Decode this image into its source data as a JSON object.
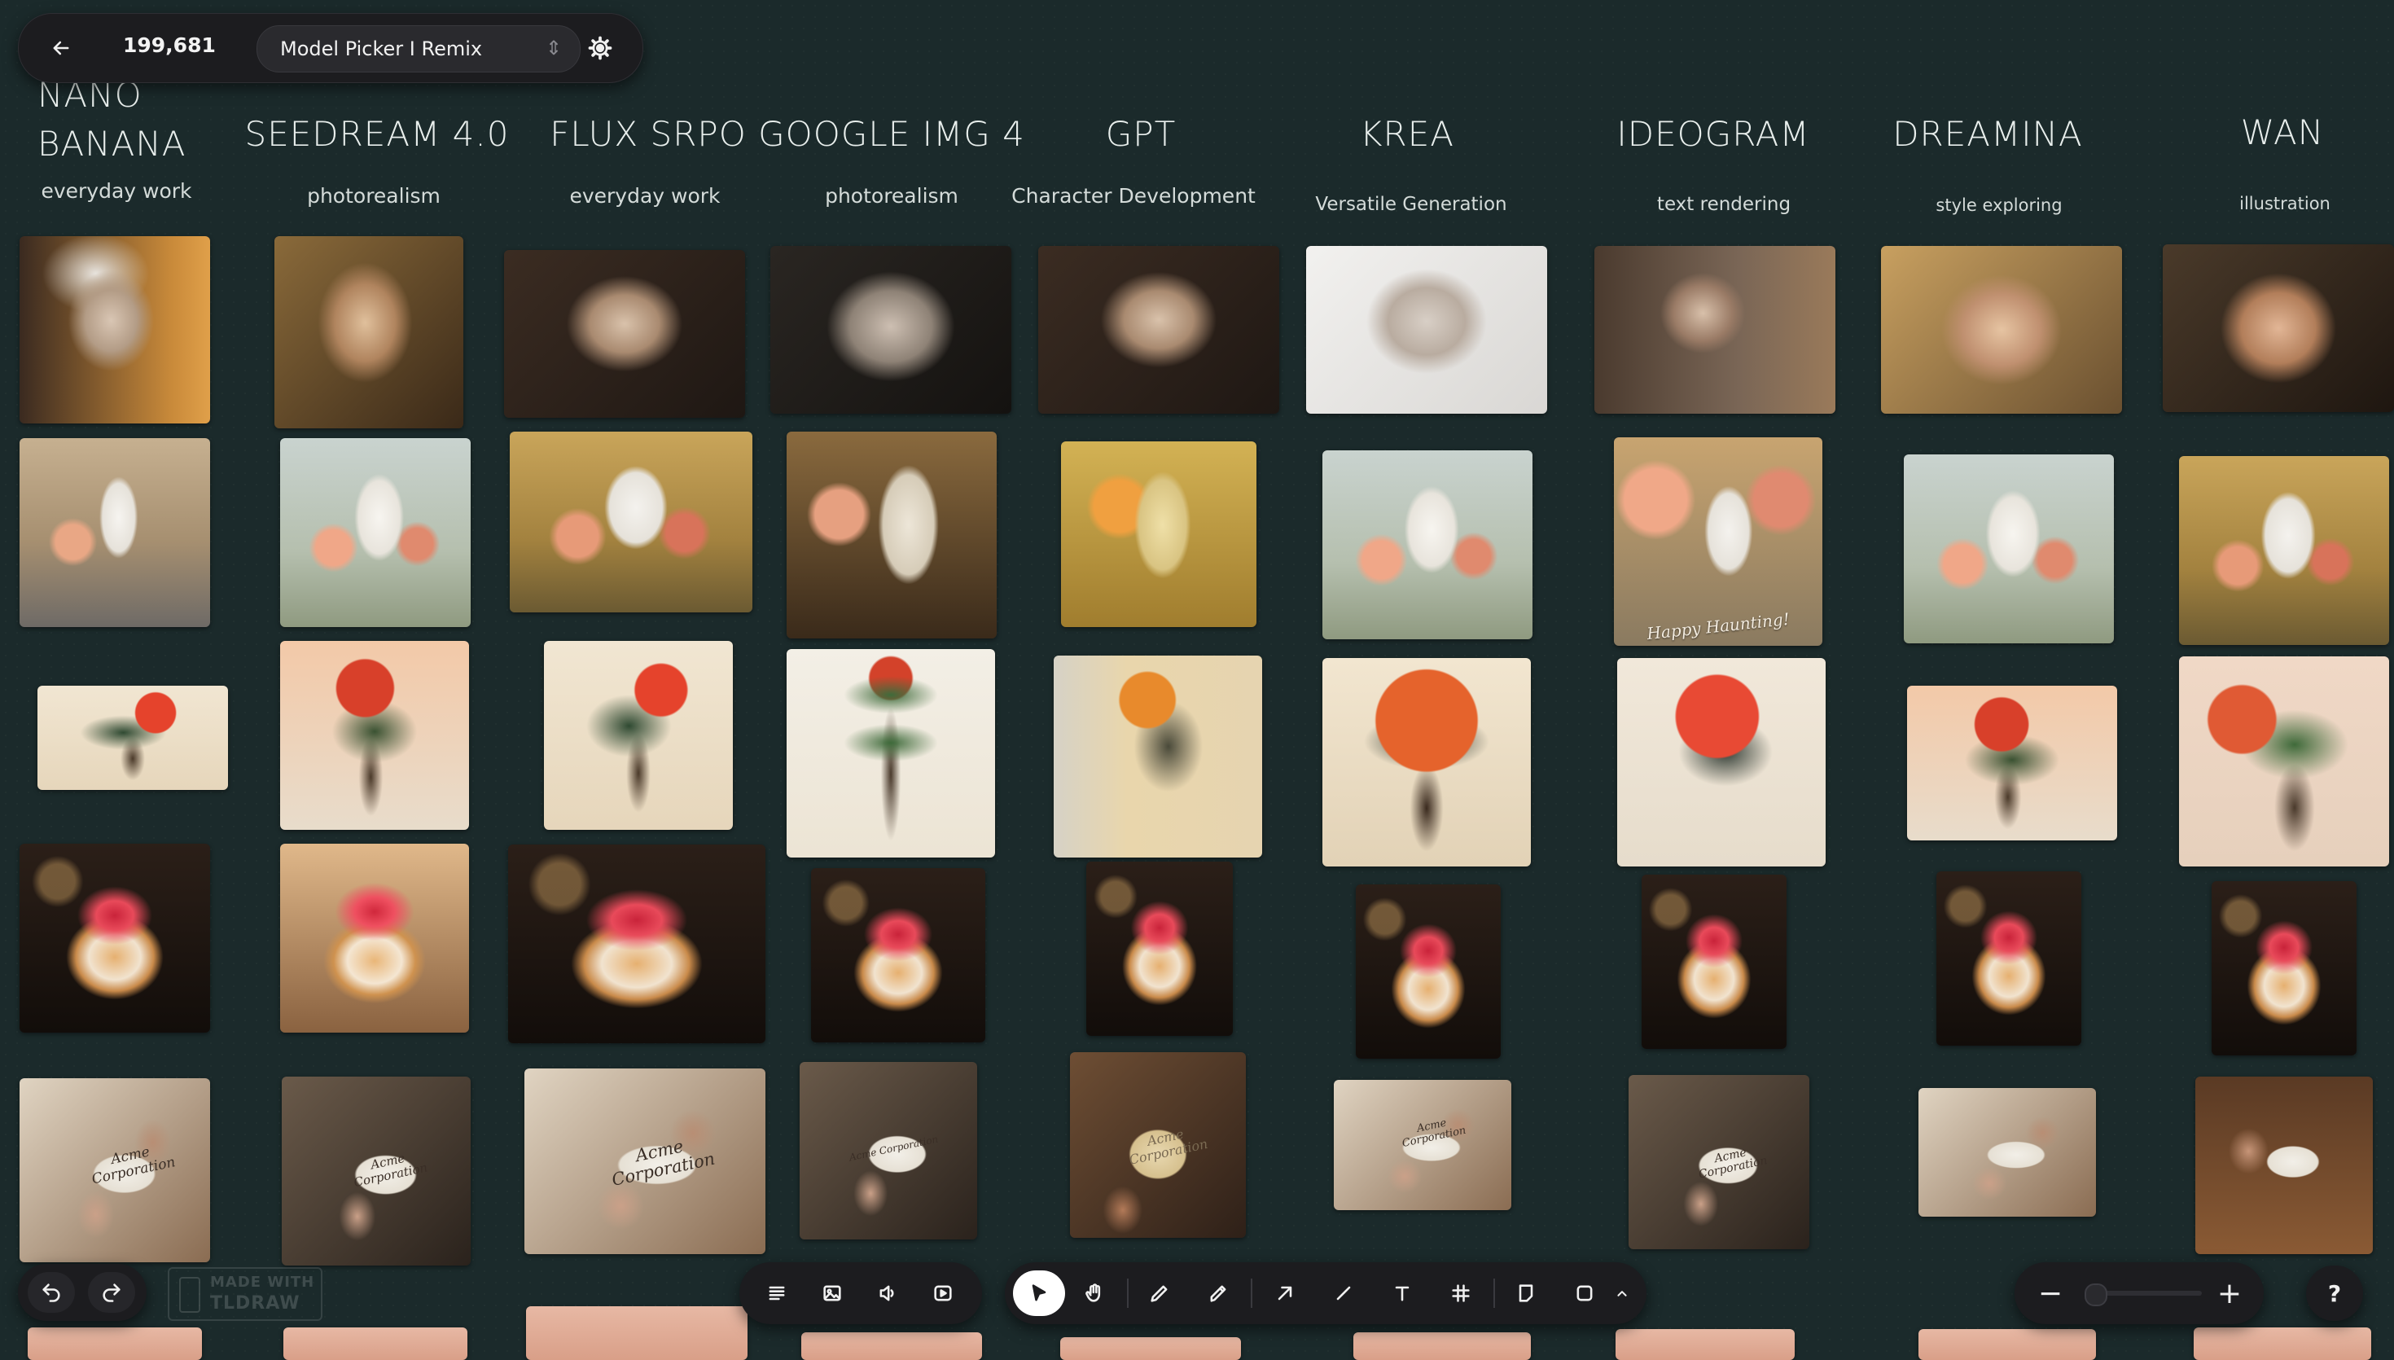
{
  "toolbar_top": {
    "back_label": "←",
    "credits": "199,681",
    "model_picker_value": "Model Picker I Remix",
    "select_arrows": "⇕"
  },
  "columns": [
    {
      "title_line1": "NANO",
      "title_line2": "BANANA",
      "subtitle": "everyday work"
    },
    {
      "title": "SEEDREAM 4.0",
      "subtitle": "photorealism"
    },
    {
      "title": "FLUX SRPO",
      "subtitle": "everyday work"
    },
    {
      "title": "GOOGLE IMG 4",
      "subtitle": "photorealism"
    },
    {
      "title": "GPT",
      "subtitle": "Character Development"
    },
    {
      "title": "KREA",
      "subtitle": "Versatile Generation"
    },
    {
      "title": "IDEOGRAM",
      "subtitle": "text rendering"
    },
    {
      "title": "DREAMINA",
      "subtitle": "style exploring"
    },
    {
      "title": "WAN",
      "subtitle": "illustration"
    }
  ],
  "card_texts": {
    "nano": "Acme\nCorporation",
    "seedream": "Acme\nCorporation",
    "flux": "Acme\nCorporation",
    "google": "Acme Corporation",
    "gpt": "Acme\nCorporation",
    "krea": "Acme\nCorporation",
    "ideogram": "Acme\nCorporation"
  },
  "happy_haunting": "Happy Haunting!",
  "watermark": {
    "line1": "MADE WITH",
    "line2": "TLDRAW"
  },
  "help_label": "?",
  "zoom": {
    "minus": "−",
    "plus": "+"
  },
  "tools": [
    "text-tool",
    "image-tool",
    "audio-tool",
    "video-tool",
    "select",
    "hand",
    "draw",
    "highlight",
    "arrow",
    "line",
    "text",
    "frame",
    "note",
    "rectangle",
    "more"
  ],
  "colors": {
    "canvas": "#1b2a2b",
    "panel": "#1c1c1f",
    "accent_white": "#ffffff"
  }
}
